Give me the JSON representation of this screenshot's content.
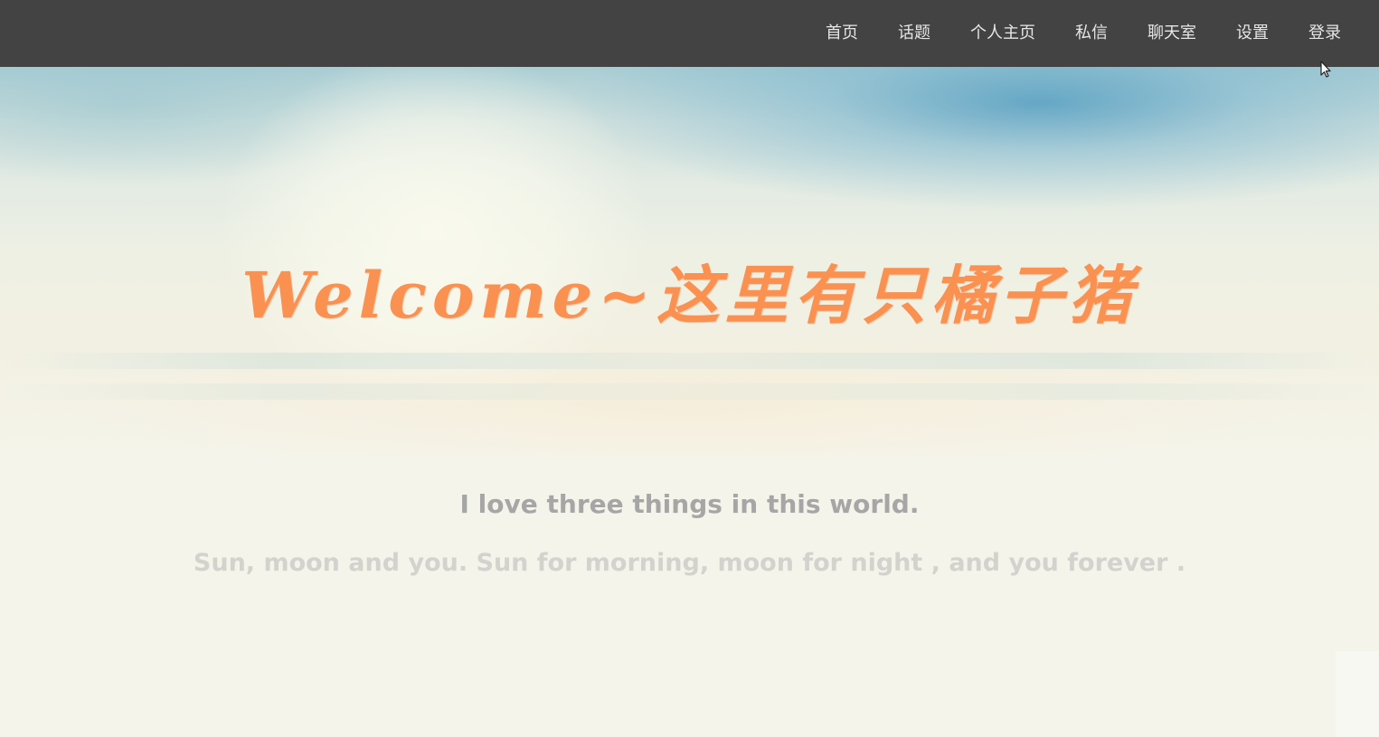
{
  "nav": {
    "items": [
      {
        "label": "首页"
      },
      {
        "label": "话题"
      },
      {
        "label": "个人主页"
      },
      {
        "label": "私信"
      },
      {
        "label": "聊天室"
      },
      {
        "label": "设置"
      },
      {
        "label": "登录"
      }
    ]
  },
  "hero": {
    "title": "Welcome~这里有只橘子猪"
  },
  "quote": {
    "line1": "I love three things in this world.",
    "line2": "Sun, moon and you. Sun for morning, moon for night , and you forever ."
  },
  "colors": {
    "navbar_bg": "#434343",
    "nav_text": "#e6e6e6",
    "title_orange": "#fa9151",
    "quote_primary": "#a6a6a6",
    "quote_secondary": "#d3d3ce",
    "page_bg": "#f5f4ea"
  },
  "icons": {
    "cursor": "mouse-pointer-icon"
  }
}
